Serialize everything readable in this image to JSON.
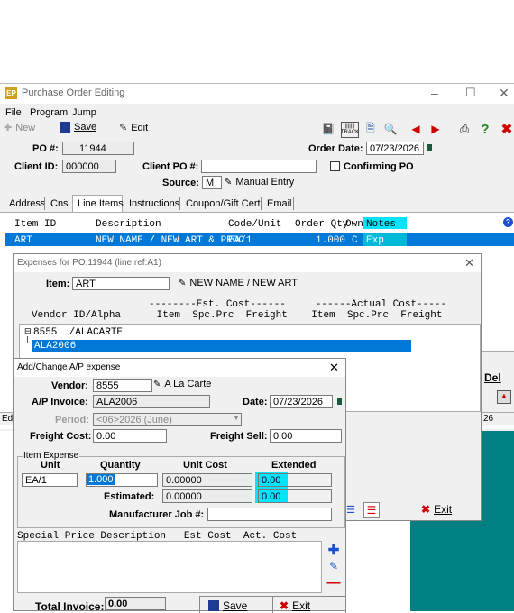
{
  "main_window": {
    "title": "Purchase Order Editing",
    "menu": [
      "File",
      "Program",
      "Jump"
    ],
    "toolbar": {
      "new": "New",
      "save": "Save",
      "edit": "Edit",
      "track_label": "TRACK"
    },
    "po_label": "PO #:",
    "po_value": "11944",
    "order_date_label": "Order Date:",
    "order_date": "07/23/2026",
    "client_id_label": "Client ID:",
    "client_id": "000000",
    "client_po_label": "Client PO #:",
    "client_po": "",
    "confirming_label": "Confirming PO",
    "source_label": "Source:",
    "source_value": "M",
    "manual_entry": "Manual Entry",
    "tabs": [
      "Address",
      "Cns",
      "Line Items",
      "Instructions",
      "Coupon/Gift Cert.",
      "Email"
    ],
    "grid_headers": {
      "item_id": "Item ID",
      "description": "Description",
      "code_unit": "Code/Unit",
      "order_qty": "Order Qty",
      "own": "Own",
      "notes": "Notes"
    },
    "grid_row": {
      "item_id": "ART",
      "description": "NEW NAME / NEW ART & PROO",
      "code_unit": "EA/1",
      "order_qty": "1.000",
      "own": "C",
      "notes": "Exp"
    },
    "side_partial": {
      "del": "Del",
      "col_value": "26"
    }
  },
  "expenses_window": {
    "title": "Expenses for PO:11944  (line ref:A1)",
    "item_label": "Item:",
    "item_value": "ART",
    "item_desc": "NEW NAME / NEW ART",
    "header_line1": "--------Est. Cost------     ------Actual Cost-----",
    "header_line2": "Vendor ID/Alpha      Item  Spc.Prc  Freight    Item  Spc.Prc  Freight",
    "tree_parent": "8555  /ALACARTE",
    "tree_child": "ALA2006",
    "exit": "Exit"
  },
  "ap_window": {
    "title": "Add/Change A/P expense",
    "vendor_label": "Vendor:",
    "vendor_value": "8555",
    "vendor_name": "A La Carte",
    "ap_invoice_label": "A/P Invoice:",
    "ap_invoice": "ALA2006",
    "date_label": "Date:",
    "date": "07/23/2026",
    "period_label": "Period:",
    "period": "<06>2026 (June)",
    "freight_cost_label": "Freight Cost:",
    "freight_cost": "0.00",
    "freight_sell_label": "Freight Sell:",
    "freight_sell": "0.00",
    "group_label": "Item Expense",
    "col_unit": "Unit",
    "col_quantity": "Quantity",
    "col_unit_cost": "Unit Cost",
    "col_extended": "Extended",
    "unit": "EA/1",
    "quantity": "1.000",
    "unit_cost": "0.00000",
    "extended": "0.00",
    "estimated_label": "Estimated:",
    "estimated_cost": "0.00000",
    "estimated_ext": "0.00",
    "mfr_job_label": "Manufacturer Job #:",
    "mfr_job": "",
    "special_header": "Special Price Description   Est Cost  Act. Cost",
    "total_label": "Total Invoice:",
    "total_value": "0.00",
    "save": "Save",
    "exit": "Exit"
  },
  "colors": {
    "selection": "#0078d7",
    "highlight": "#00e5ff",
    "teal": "#008080"
  }
}
